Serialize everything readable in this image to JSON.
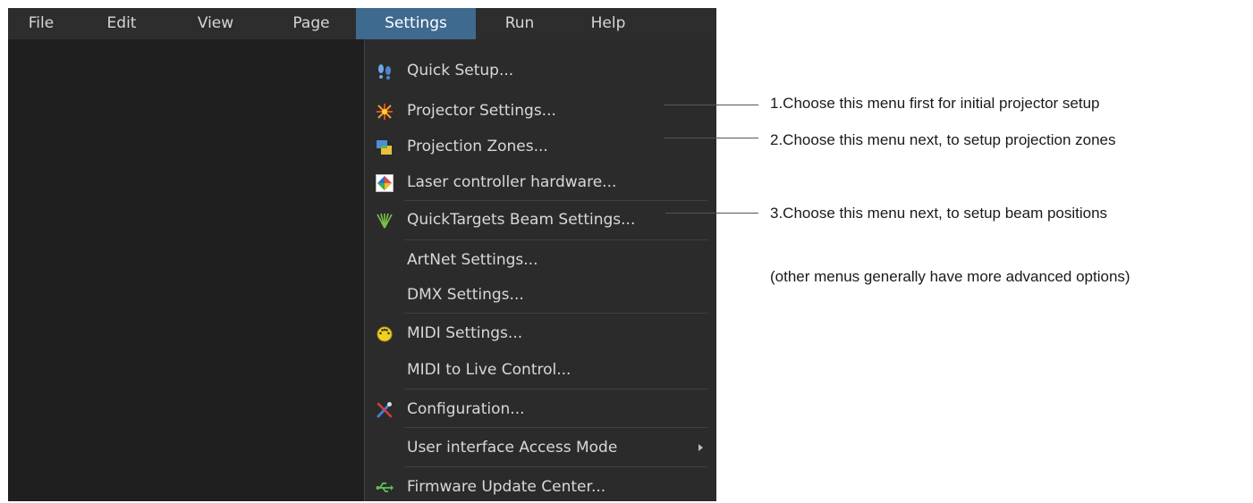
{
  "menubar": {
    "items": [
      {
        "label": "File"
      },
      {
        "label": "Edit"
      },
      {
        "label": "View"
      },
      {
        "label": "Page"
      },
      {
        "label": "Settings",
        "active": true
      },
      {
        "label": "Run"
      },
      {
        "label": "Help"
      }
    ]
  },
  "settings_menu": {
    "items": [
      {
        "label": "Quick Setup...",
        "icon": "footprints-icon"
      },
      {
        "label": "Projector Settings...",
        "icon": "laser-burst-icon"
      },
      {
        "label": "Projection Zones...",
        "icon": "zones-icon"
      },
      {
        "label": "Laser controller hardware...",
        "icon": "color-square-icon"
      },
      {
        "label": "QuickTargets Beam Settings...",
        "icon": "beams-icon"
      },
      {
        "label": "ArtNet Settings...",
        "icon": ""
      },
      {
        "label": "DMX Settings...",
        "icon": ""
      },
      {
        "label": "MIDI Settings...",
        "icon": "midi-connector-icon"
      },
      {
        "label": "MIDI to Live Control...",
        "icon": ""
      },
      {
        "label": "Configuration...",
        "icon": "tools-icon"
      },
      {
        "label": "User interface Access Mode",
        "icon": "",
        "submenu": true
      },
      {
        "label": "Firmware Update Center...",
        "icon": "usb-icon"
      }
    ]
  },
  "annotations": {
    "step1": "1.Choose this menu first for initial projector setup",
    "step2": "2.Choose this menu next, to setup projection zones",
    "step3": "3.Choose this menu next, to setup beam positions",
    "note": "(other menus generally have more advanced options)"
  },
  "colors": {
    "app_background": "#1f1f1f",
    "menubar": "#2d2d2d",
    "active_menu": "#3e6a8f",
    "menu_text": "#d8d8d8"
  }
}
